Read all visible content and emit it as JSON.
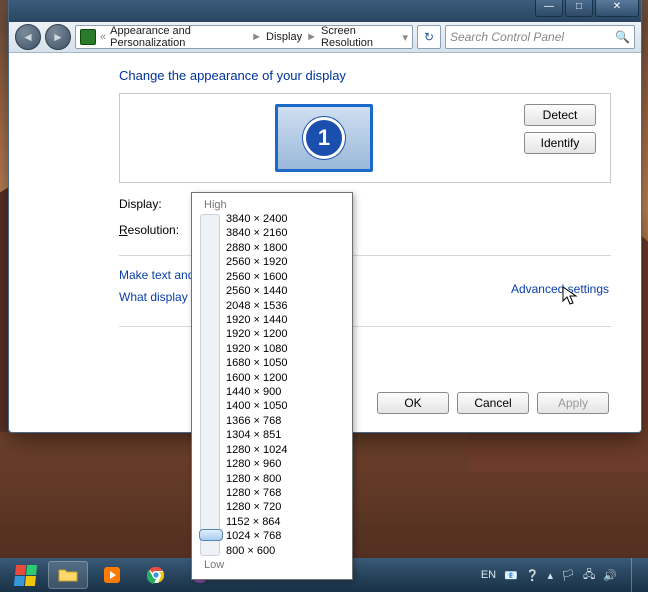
{
  "titlebar": {
    "min": "—",
    "max": "□",
    "close": "✕"
  },
  "nav": {
    "back": "◄",
    "fwd": "►",
    "chevrons": "«",
    "seg1": "Appearance and Personalization",
    "seg2": "Display",
    "seg3": "Screen Resolution",
    "sep": "►",
    "dd": "▾",
    "refresh": "↻",
    "search_placeholder": "Search Control Panel",
    "search_icon": "🔍"
  },
  "page": {
    "heading": "Change the appearance of your display",
    "monitor_number": "1",
    "detect": "Detect",
    "identify": "Identify",
    "display_label": "Display:",
    "resolution_label": "Resolution:",
    "resolution_label_plain": "esolution:",
    "resolution_key": "R",
    "advanced": "Advanced settings",
    "link1": "Make text and other",
    "link2": "What display setting",
    "ok": "OK",
    "cancel": "Cancel",
    "apply": "Apply"
  },
  "res": {
    "high": "High",
    "low": "Low",
    "selected_index": 22,
    "items": [
      "3840 × 2400",
      "3840 × 2160",
      "2880 × 1800",
      "2560 × 1920",
      "2560 × 1600",
      "2560 × 1440",
      "2048 × 1536",
      "1920 × 1440",
      "1920 × 1200",
      "1920 × 1080",
      "1680 × 1050",
      "1600 × 1200",
      "1440 × 900",
      "1400 × 1050",
      "1366 × 768",
      "1304 × 851",
      "1280 × 1024",
      "1280 × 960",
      "1280 × 800",
      "1280 × 768",
      "1280 × 720",
      "1152 × 864",
      "1024 × 768",
      "800 × 600"
    ]
  },
  "tray": {
    "lang": "EN",
    "up": "▴"
  }
}
